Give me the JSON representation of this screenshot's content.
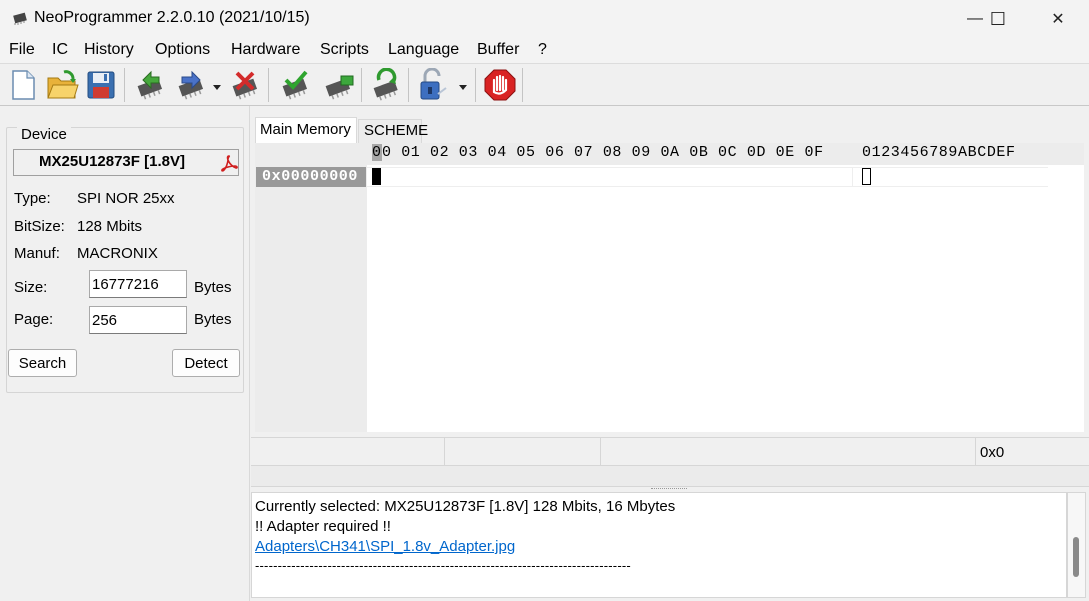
{
  "window": {
    "title": "NeoProgrammer 2.2.0.10 (2021/10/15)",
    "minimize": "—",
    "maximize": "☐",
    "close": "✕"
  },
  "menu": [
    "File",
    "IC",
    "History",
    "Options",
    "Hardware",
    "Scripts",
    "Language",
    "Buffer",
    "?"
  ],
  "toolbar": {
    "icons": [
      "new-file-icon",
      "open-folder-icon",
      "save-icon",
      "read-chip-icon",
      "write-chip-icon",
      "write-dropdown-icon",
      "erase-chip-icon",
      "verify-chip-icon",
      "blank-check-icon",
      "auto-detect-icon",
      "protect-lock-icon",
      "protect-dropdown-icon",
      "stop-icon"
    ]
  },
  "device": {
    "legend": "Device",
    "chip": "MX25U12873F [1.8V]",
    "type_label": "Type:",
    "type_value": "SPI NOR 25xx",
    "bitsize_label": "BitSize:",
    "bitsize_value": "128 Mbits",
    "manuf_label": "Manuf:",
    "manuf_value": "MACRONIX",
    "size_label": "Size:",
    "size_value": "16777216",
    "size_unit": "Bytes",
    "page_label": "Page:",
    "page_value": "256",
    "page_unit": "Bytes",
    "search_button": "Search",
    "detect_button": "Detect"
  },
  "tabs": [
    "Main Memory",
    "SCHEME"
  ],
  "hex": {
    "header_first": "0",
    "header_rest": "0 01 02 03 04 05 06 07 08 09 0A 0B 0C 0D 0E 0F",
    "ascii_header": "0123456789ABCDEF",
    "address": "0x00000000"
  },
  "status": {
    "offset": "0x0"
  },
  "log": {
    "line1": "Currently selected:  MX25U12873F [1.8V] 128 Mbits, 16 Mbytes",
    "line2": "!! Adapter required !!",
    "link": "Adapters\\CH341\\SPI_1.8v_Adapter.jpg",
    "divider": "-----------------------------------------------------------------------------------"
  },
  "colors": {
    "link": "#0066cc",
    "address_bg": "#999999",
    "stop_red": "#d92323"
  }
}
